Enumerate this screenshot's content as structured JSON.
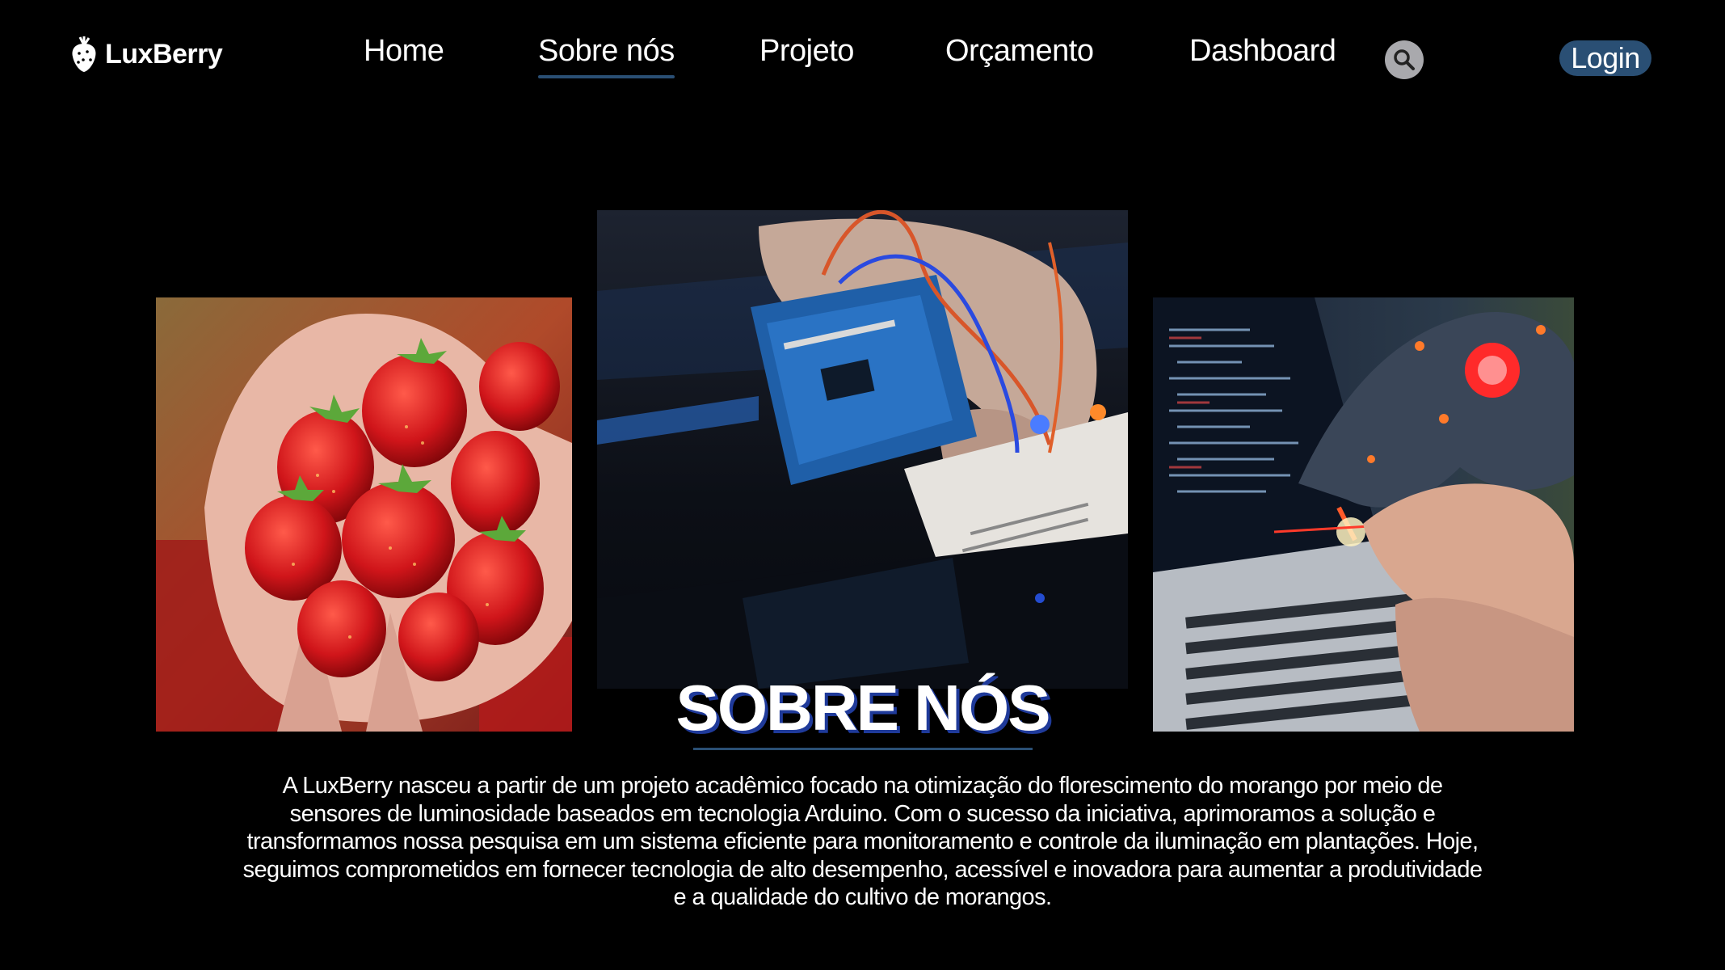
{
  "brand": {
    "name": "LuxBerry"
  },
  "nav": {
    "items": [
      {
        "label": "Home"
      },
      {
        "label": "Sobre nós",
        "active": true
      },
      {
        "label": "Projeto"
      },
      {
        "label": "Orçamento"
      },
      {
        "label": "Dashboard"
      }
    ],
    "search_icon": "search-icon",
    "login_label": "Login"
  },
  "colors": {
    "background": "#000000",
    "accent": "#2a4f74",
    "search_bg": "#a9a9ad"
  },
  "gallery": {
    "photos": [
      {
        "subject": "strawberries-in-hands"
      },
      {
        "subject": "arduino-breadboard"
      },
      {
        "subject": "robot-hand-laptop"
      }
    ]
  },
  "about": {
    "title": "SOBRE NÓS",
    "text": "A LuxBerry nasceu a partir de um projeto acadêmico focado na otimização do florescimento do morango por meio de sensores de luminosidade baseados em tecnologia Arduino. Com o sucesso da iniciativa, aprimoramos a solução e transformamos nossa pesquisa em um sistema eficiente para monitoramento e controle da iluminação em plantações. Hoje, seguimos comprometidos em fornecer tecnologia de alto desempenho, acessível e inovadora para aumentar a produtividade e a qualidade do cultivo de morangos."
  }
}
